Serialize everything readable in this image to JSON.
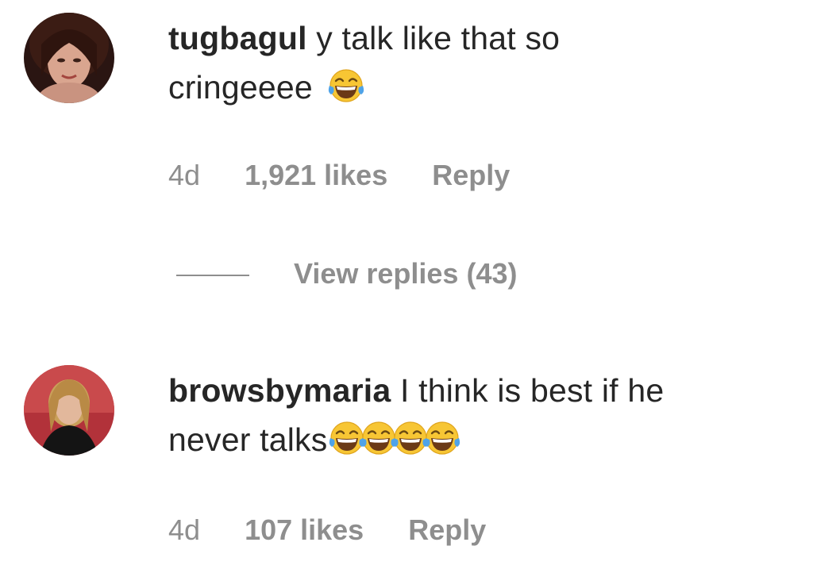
{
  "comments": [
    {
      "username": "tugbagul",
      "text_line1": "y talk like that so",
      "text_line2": "cringeeee",
      "emoji": "face-with-tears-of-joy",
      "emoji_count": 1,
      "time": "4d",
      "likes": "1,921 likes",
      "reply_label": "Reply"
    },
    {
      "username": "browsbymaria",
      "text_line1": "I think is best if he",
      "text_line2": "never talks",
      "emoji": "face-with-tears-of-joy",
      "emoji_count": 4,
      "time": "4d",
      "likes": "107 likes",
      "reply_label": "Reply"
    }
  ],
  "view_replies": "View replies (43)",
  "colors": {
    "text_primary": "#262626",
    "text_secondary": "#8e8e8e",
    "background": "#ffffff"
  }
}
